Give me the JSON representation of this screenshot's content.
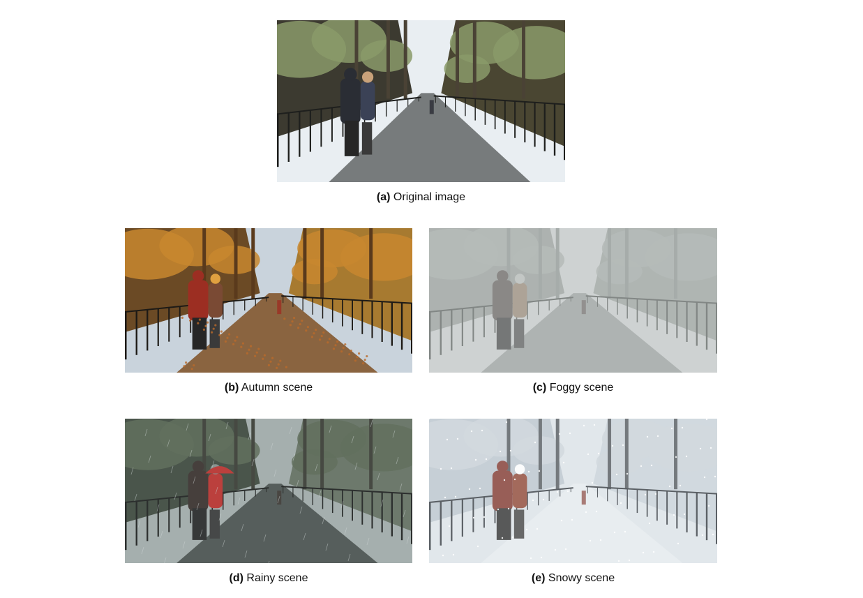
{
  "figure": {
    "panels": [
      {
        "id": "a",
        "label": "(a)",
        "caption": "Original image",
        "scene": "original"
      },
      {
        "id": "b",
        "label": "(b)",
        "caption": "Autumn scene",
        "scene": "autumn"
      },
      {
        "id": "c",
        "label": "(c)",
        "caption": "Foggy scene",
        "scene": "foggy"
      },
      {
        "id": "d",
        "label": "(d)",
        "caption": "Rainy scene",
        "scene": "rainy"
      },
      {
        "id": "e",
        "label": "(e)",
        "caption": "Snowy scene",
        "scene": "snowy"
      }
    ]
  },
  "palettes": {
    "original": {
      "sky": "#e9eef2",
      "trees": "#4a4235",
      "foliage": "#8a9a6a",
      "path": "#777b7c",
      "fence": "#1e1f1d",
      "left": "#3c3a30",
      "right": "#4a4632",
      "person1": "#2a2d34",
      "person2": "#3b4256",
      "accent": "#c9a27a"
    },
    "autumn": {
      "sky": "#c9d3dc",
      "trees": "#5a3a1c",
      "foliage": "#c8872f",
      "path": "#8a6440",
      "fence": "#1d1a16",
      "left": "#6b4a25",
      "right": "#a77a30",
      "person1": "#9c2e22",
      "person2": "#7a4a34",
      "accent": "#e0a040"
    },
    "foggy": {
      "sky": "#c7cbcb",
      "trees": "#7f8582",
      "foliage": "#9aa19c",
      "path": "#8d9290",
      "fence": "#3d423f",
      "left": "#8a918c",
      "right": "#8f9691",
      "person1": "#4c4440",
      "person2": "#8a7560",
      "accent": "#b2b6b3"
    },
    "rainy": {
      "sky": "#aeb7b6",
      "trees": "#3a3b33",
      "foliage": "#5c6b55",
      "path": "#4e5552",
      "fence": "#1a1c1a",
      "left": "#3f4a3d",
      "right": "#6a7666",
      "person1": "#3a2f2b",
      "person2": "#c9302d",
      "accent": "#8b9793"
    },
    "snowy": {
      "sky": "#dde3e8",
      "trees": "#4b5056",
      "foliage": "#c8d0d7",
      "path": "#e6ebef",
      "fence": "#2a2f36",
      "left": "#b9c3cc",
      "right": "#c7d0d8",
      "person1": "#7b2d23",
      "person2": "#8a3c2a",
      "accent": "#ffffff"
    }
  }
}
